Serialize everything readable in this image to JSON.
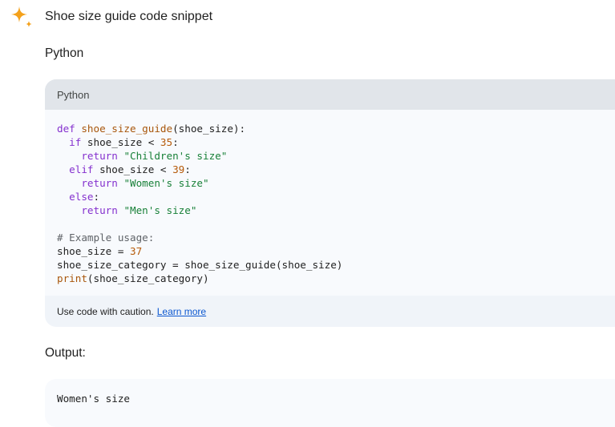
{
  "header": {
    "title": "Shoe size guide code snippet",
    "icon": "sparkle-icon"
  },
  "section": {
    "language_heading": "Python"
  },
  "code_block": {
    "language_label": "Python",
    "lines": [
      [
        {
          "t": "def",
          "c": "kw"
        },
        {
          "t": " "
        },
        {
          "t": "shoe_size_guide",
          "c": "fn"
        },
        {
          "t": "(shoe_size):"
        }
      ],
      [
        {
          "t": "  "
        },
        {
          "t": "if",
          "c": "kw"
        },
        {
          "t": " shoe_size < "
        },
        {
          "t": "35",
          "c": "num"
        },
        {
          "t": ":"
        }
      ],
      [
        {
          "t": "    "
        },
        {
          "t": "return",
          "c": "kw"
        },
        {
          "t": " "
        },
        {
          "t": "\"Children's size\"",
          "c": "str"
        }
      ],
      [
        {
          "t": "  "
        },
        {
          "t": "elif",
          "c": "kw"
        },
        {
          "t": " shoe_size < "
        },
        {
          "t": "39",
          "c": "num"
        },
        {
          "t": ":"
        }
      ],
      [
        {
          "t": "    "
        },
        {
          "t": "return",
          "c": "kw"
        },
        {
          "t": " "
        },
        {
          "t": "\"Women's size\"",
          "c": "str"
        }
      ],
      [
        {
          "t": "  "
        },
        {
          "t": "else",
          "c": "kw"
        },
        {
          "t": ":"
        }
      ],
      [
        {
          "t": "    "
        },
        {
          "t": "return",
          "c": "kw"
        },
        {
          "t": " "
        },
        {
          "t": "\"Men's size\"",
          "c": "str"
        }
      ],
      [],
      [
        {
          "t": "# Example usage:",
          "c": "cm"
        }
      ],
      [
        {
          "t": "shoe_size = "
        },
        {
          "t": "37",
          "c": "num"
        }
      ],
      [
        {
          "t": "shoe_size_category = shoe_size_guide(shoe_size)"
        }
      ],
      [
        {
          "t": "print",
          "c": "fn"
        },
        {
          "t": "(shoe_size_category)"
        }
      ]
    ],
    "footer_text": "Use code with caution.",
    "footer_link": "Learn more"
  },
  "output": {
    "heading": "Output:",
    "lines": [
      "Women's size"
    ]
  },
  "colors": {
    "accent_sparkle": "#f4a11b",
    "link": "#0b57d0",
    "keyword": "#8430ce",
    "string": "#188038",
    "number": "#b55908"
  }
}
